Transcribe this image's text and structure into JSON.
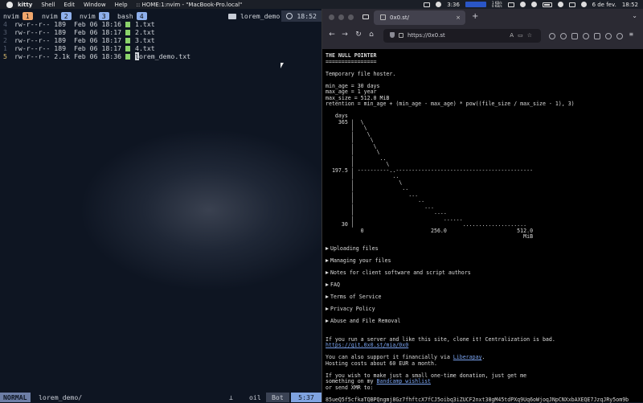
{
  "menubar": {
    "app": "kitty",
    "items": [
      "Shell",
      "Edit",
      "Window",
      "Help"
    ],
    "window_title": ":: HOME:1:nvim - \"MacBook-Pro.local\"",
    "time_small": "3:36",
    "netspeed_up": "1 KB/s",
    "netspeed_down": "0 KB/s",
    "date": "6 de fev.",
    "clock": "18:52"
  },
  "terminal": {
    "tabs": [
      {
        "label": "nvim",
        "num": "1",
        "color": "#f0a66c"
      },
      {
        "label": "nvim",
        "num": "2",
        "color": "#8fb0ec"
      },
      {
        "label": "nvim",
        "num": "3",
        "color": "#8fb0ec"
      },
      {
        "label": "bash",
        "num": "4",
        "color": "#8fb0ec"
      }
    ],
    "session": "lorem_demo",
    "clock": "18:52",
    "lines": [
      {
        "ln": "4",
        "text": "rw-r--r-- 189  Feb 06 18:16",
        "file": "1.txt"
      },
      {
        "ln": "3",
        "text": "rw-r--r-- 189  Feb 06 18:17",
        "file": "2.txt"
      },
      {
        "ln": "2",
        "text": "rw-r--r-- 189  Feb 06 18:17",
        "file": "3.txt"
      },
      {
        "ln": "1",
        "text": "rw-r--r-- 189  Feb 06 18:17",
        "file": "4.txt"
      },
      {
        "ln": "5",
        "text": "rw-r--r-- 2.1k Feb 06 18:36",
        "file_cursor": "l",
        "file_rest": "orem_demo.txt"
      }
    ],
    "status": {
      "mode": "NORMAL",
      "path": "lorem_demo/",
      "filetype": "oil",
      "scroll": "Bot",
      "position": "5:37"
    }
  },
  "browser": {
    "tab_title": "0x0.st/",
    "url": "https://0x0.st",
    "content": {
      "title": "THE NULL POINTER",
      "underline": "================",
      "subtitle": "Temporary file hoster.",
      "params": "min_age = 30 days\nmax_age = 1 year\nmax_size = 512.0 MiB\nretention = min_age + (min_age - max_age) * pow((file_size / max_size - 1), 3)",
      "graph": "   days\n    365 |  \\\n        |   \\\n        |    \\\n        |     \\\n        |      \\\n        |       \\\n        |        ..\n        |          \\\n  197.5 | ----------..-------------------------------------------\n        |            ..\n        |              \\\n        |               ..\n        |                 ...\n        |                    ..\n        |                      ...\n        |                         ....\n        |                            ......\n     30 |                                  ....................\n           0                     256.0                      512.0\n                                                              MiB",
      "sections": [
        "Uploading files",
        "Managing your files",
        "Notes for client software and script authors",
        "FAQ",
        "Terms of Service",
        "Privacy Policy",
        "Abuse and File Removal"
      ],
      "clone_text": "If you run a server and like this site, clone it! Centralization is bad.",
      "clone_link": "https://git.0x0.st/mia/0x0",
      "support_text": "You can also support it financially via ",
      "support_link": "Liberapay",
      "hosting_text": "Hosting costs about 60 EUR a month.",
      "donation_text_1": "If you wish to make just a small one-time donation, just get me",
      "donation_text_2": "something on my ",
      "donation_link": "Bandcamp wishlist",
      "xmr_text": "or send XMR to:",
      "xmr_address": "85ueQ5f5cfkaTQBPQngmj8Gz7fhftcX7fCJ5oibq3iZUCF2nxt38gM45tdPXq9Uq6oWjoqJNpCNXxbAXEQE7JzqJRy5om9b"
    }
  }
}
